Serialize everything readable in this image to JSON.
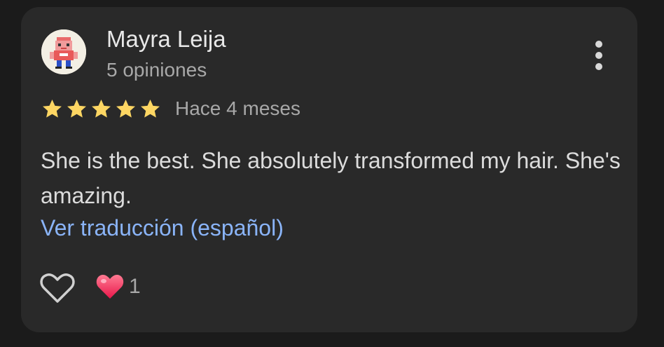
{
  "review": {
    "author_name": "Mayra Leija",
    "review_count": "5 opiniones",
    "rating": 5,
    "rating_max": 5,
    "timestamp": "Hace 4 meses",
    "text": "She is the best. She absolutely transformed my hair. She's amazing.",
    "translate_label": "Ver traducción (español)",
    "reaction_count": "1"
  },
  "icons": {
    "avatar": "pixel-art-avatar",
    "menu": "more-vert-icon",
    "star": "star-icon",
    "like": "heart-outline-icon",
    "reaction": "heart-emoji-icon"
  },
  "colors": {
    "card_background": "#292929",
    "page_background": "#1b1b1b",
    "star": "#fdd663",
    "link": "#8ab4f8",
    "reaction_heart": "#ff4d6d"
  }
}
